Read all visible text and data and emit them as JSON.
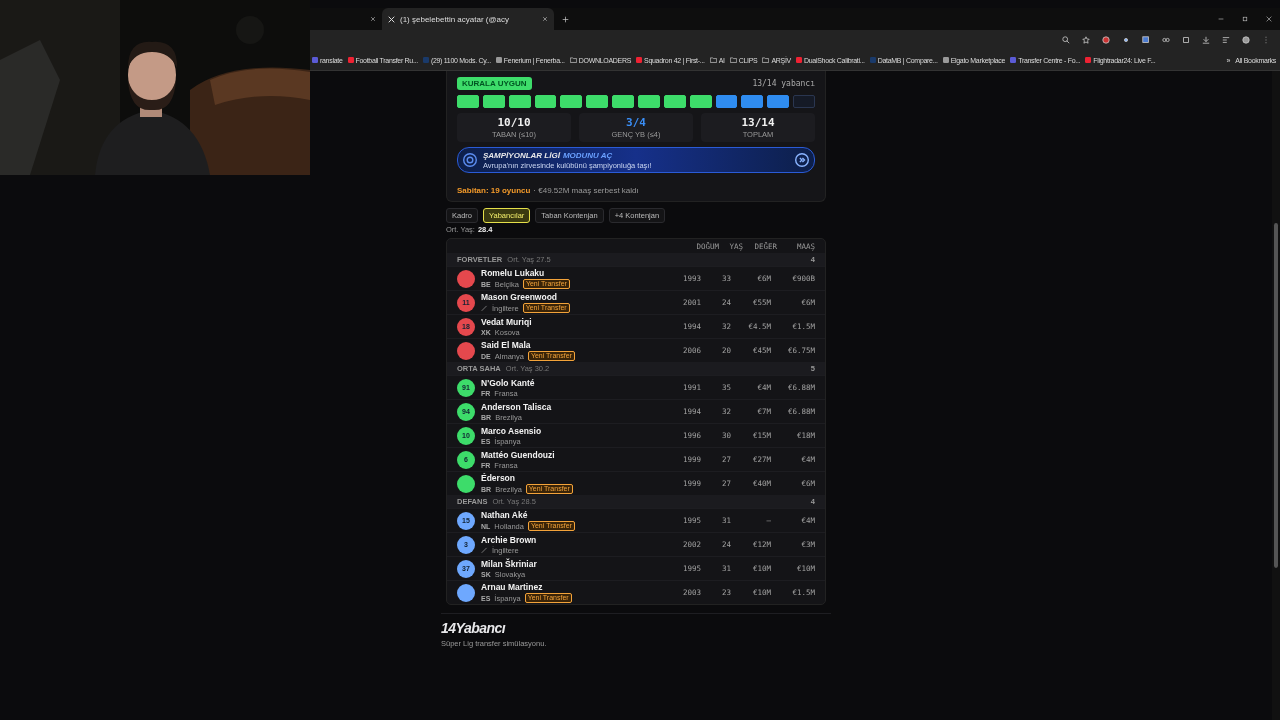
{
  "browser": {
    "tabs": [
      {
        "selected": false
      },
      {
        "title": "(1) şebelebettin acyatar (@acy",
        "selected": true
      }
    ],
    "bookmarks": [
      {
        "label": "ranslate",
        "kind": "link"
      },
      {
        "label": "Football Transfer Ru...",
        "kind": "link"
      },
      {
        "label": "(29) 1100 Mods. Cy...",
        "kind": "link"
      },
      {
        "label": "Fenerium | Fenerba...",
        "kind": "link"
      },
      {
        "label": "DOWNLOADERS",
        "kind": "folder"
      },
      {
        "label": "Squadron 42 | First-...",
        "kind": "link"
      },
      {
        "label": "AI",
        "kind": "folder"
      },
      {
        "label": "CLIPS",
        "kind": "folder"
      },
      {
        "label": "ARŞİV",
        "kind": "folder"
      },
      {
        "label": "DualShock Calibrati...",
        "kind": "link"
      },
      {
        "label": "DataMB | Compare...",
        "kind": "link"
      },
      {
        "label": "Elgato Marketplace",
        "kind": "link"
      },
      {
        "label": "Transfer Centre - Fo...",
        "kind": "link"
      },
      {
        "label": "Flightradar24: Live F...",
        "kind": "link"
      }
    ],
    "more": "»",
    "all_bookmarks": "All Bookmarks"
  },
  "summary": {
    "badge": "KURALA UYGUN",
    "count": "13/14 yabancı",
    "slots": [
      {
        "kind": "taban"
      },
      {
        "kind": "taban"
      },
      {
        "kind": "taban"
      },
      {
        "kind": "taban"
      },
      {
        "kind": "taban"
      },
      {
        "kind": "taban"
      },
      {
        "kind": "taban"
      },
      {
        "kind": "taban"
      },
      {
        "kind": "taban"
      },
      {
        "kind": "taban"
      },
      {
        "kind": "genc"
      },
      {
        "kind": "genc"
      },
      {
        "kind": "genc"
      },
      {
        "kind": "empty"
      }
    ],
    "stats": [
      {
        "value": "10/10",
        "label": "TABAN (≤10)",
        "kind": "plain"
      },
      {
        "value": "3/4",
        "label": "GENÇ YB (≤4)",
        "kind": "accent"
      },
      {
        "value": "13/14",
        "label": "TOPLAM",
        "kind": "plain"
      }
    ],
    "banner": {
      "title": "ŞAMPİYONLAR LİGİ",
      "title_highlight": "MODUNU AÇ",
      "subtitle": "Avrupa'nın zirvesinde kulübünü şampiyonluğa taşı!"
    },
    "note_highlight": "Sabitan: 19 oyuncu",
    "note": "· €49.52M maaş serbest kaldı"
  },
  "tabs": [
    {
      "label": "Kadro",
      "selected": false
    },
    {
      "label": "Yabancılar",
      "selected": true
    },
    {
      "label": "Taban Kontenjan",
      "selected": false
    },
    {
      "label": "+4 Kontenjan",
      "selected": false
    }
  ],
  "avg_age_label": "Ort. Yaş:",
  "avg_age": "28.4",
  "table": {
    "columns": [
      "DOĞUM",
      "YAŞ",
      "DEĞER",
      "MAAŞ"
    ],
    "sections": [
      {
        "title": "FORVETLER",
        "meta": "Ort. Yaş 27.5",
        "count": "4",
        "players": [
          {
            "name": "Romelu Lukaku",
            "color": "#e5484d",
            "code": "BE",
            "country": "Belçika",
            "tag": "Yeni Transfer",
            "values": [
              "1993",
              "33",
              "€6M",
              "€900B"
            ]
          },
          {
            "name": "Mason Greenwood",
            "number": "11",
            "color": "#e5484d",
            "country": "İngiltere",
            "tag": "Yeni Transfer",
            "values": [
              "2001",
              "24",
              "€55M",
              "€6M"
            ]
          },
          {
            "name": "Vedat Muriqi",
            "number": "18",
            "color": "#e5484d",
            "code": "XK",
            "country": "Kosova",
            "values": [
              "1994",
              "32",
              "€4.5M",
              "€1.5M"
            ]
          },
          {
            "name": "Said El Mala",
            "color": "#e5484d",
            "code": "DE",
            "country": "Almanya",
            "tag": "Yeni Transfer",
            "values": [
              "2006",
              "20",
              "€45M",
              "€6.75M"
            ]
          }
        ]
      },
      {
        "title": "ORTA SAHA",
        "meta": "Ort. Yaş 30.2",
        "count": "5",
        "players": [
          {
            "name": "N'Golo Kanté",
            "number": "91",
            "color": "#3ddc6a",
            "code": "FR",
            "country": "Fransa",
            "values": [
              "1991",
              "35",
              "€4M",
              "€6.88M"
            ]
          },
          {
            "name": "Anderson Talisca",
            "number": "94",
            "color": "#3ddc6a",
            "code": "BR",
            "country": "Brezilya",
            "values": [
              "1994",
              "32",
              "€7M",
              "€6.88M"
            ]
          },
          {
            "name": "Marco Asensio",
            "number": "10",
            "color": "#3ddc6a",
            "code": "ES",
            "country": "İspanya",
            "values": [
              "1996",
              "30",
              "€15M",
              "€18M"
            ]
          },
          {
            "name": "Mattéo Guendouzi",
            "number": "6",
            "color": "#3ddc6a",
            "code": "FR",
            "country": "Fransa",
            "values": [
              "1999",
              "27",
              "€27M",
              "€4M"
            ]
          },
          {
            "name": "Éderson",
            "color": "#3ddc6a",
            "code": "BR",
            "country": "Brezilya",
            "tag": "Yeni Transfer",
            "values": [
              "1999",
              "27",
              "€40M",
              "€6M"
            ]
          }
        ]
      },
      {
        "title": "DEFANS",
        "meta": "Ort. Yaş 28.5",
        "count": "4",
        "players": [
          {
            "name": "Nathan Aké",
            "number": "15",
            "color": "#6ea8fe",
            "code": "NL",
            "country": "Hollanda",
            "tag": "Yeni Transfer",
            "values": [
              "1995",
              "31",
              "–",
              "€4M"
            ]
          },
          {
            "name": "Archie Brown",
            "number": "3",
            "color": "#6ea8fe",
            "country": "İngiltere",
            "values": [
              "2002",
              "24",
              "€12M",
              "€3M"
            ]
          },
          {
            "name": "Milan Škriniar",
            "number": "37",
            "color": "#6ea8fe",
            "code": "SK",
            "country": "Slovakya",
            "values": [
              "1995",
              "31",
              "€10M",
              "€10M"
            ]
          },
          {
            "name": "Arnau Martinez",
            "color": "#6ea8fe",
            "code": "ES",
            "country": "İspanya",
            "tag": "Yeni Transfer",
            "values": [
              "2003",
              "23",
              "€10M",
              "€1.5M"
            ]
          }
        ]
      }
    ]
  },
  "footer": {
    "brand": "14Yabancı",
    "tagline": "Süper Lig transfer simülasyonu."
  }
}
